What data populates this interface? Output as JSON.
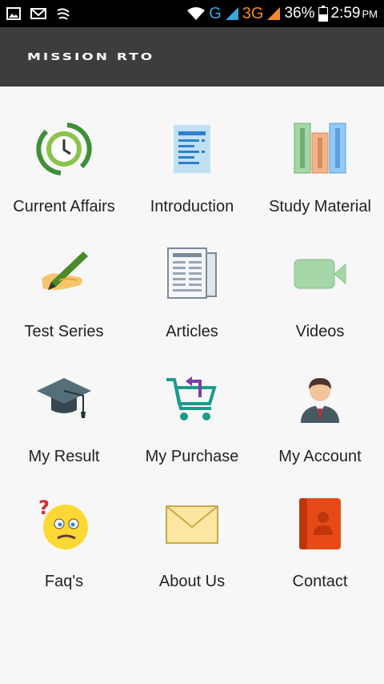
{
  "status_bar": {
    "network_g": "G",
    "network_3g": "3G",
    "battery": "36%",
    "time": "2:59",
    "time_suffix": "PM"
  },
  "app_bar": {
    "title": "MISSION RTO"
  },
  "menu": [
    {
      "label": "Current Affairs",
      "icon": "stopwatch-icon"
    },
    {
      "label": "Introduction",
      "icon": "document-icon"
    },
    {
      "label": "Study Material",
      "icon": "books-icon"
    },
    {
      "label": "Test Series",
      "icon": "pen-writing-icon"
    },
    {
      "label": "Articles",
      "icon": "newspaper-icon"
    },
    {
      "label": "Videos",
      "icon": "video-camera-icon"
    },
    {
      "label": "My Result",
      "icon": "graduation-cap-icon"
    },
    {
      "label": "My Purchase",
      "icon": "shopping-cart-icon"
    },
    {
      "label": "My Account",
      "icon": "user-icon"
    },
    {
      "label": "Faq's",
      "icon": "confused-face-icon"
    },
    {
      "label": "About Us",
      "icon": "envelope-icon"
    },
    {
      "label": "Contact",
      "icon": "contact-book-icon"
    }
  ]
}
